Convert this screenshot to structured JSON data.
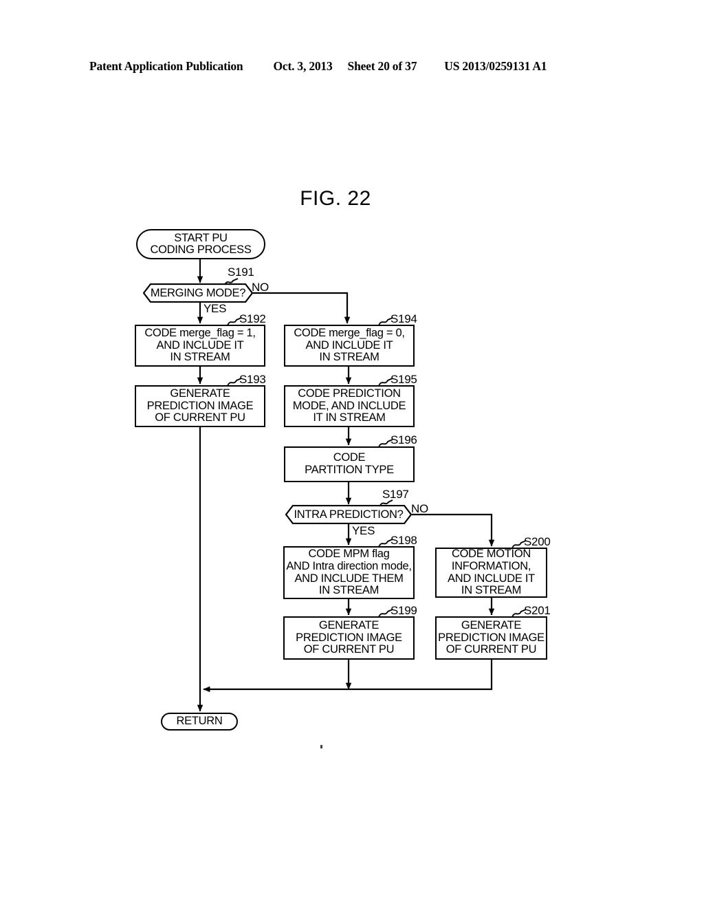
{
  "header": {
    "publication": "Patent Application Publication",
    "date": "Oct. 3, 2013",
    "sheet": "Sheet 20 of 37",
    "patent_number": "US 2013/0259131 A1"
  },
  "figure": {
    "title": "FIG. 22"
  },
  "flowchart": {
    "nodes": {
      "start": {
        "label": "START PU\nCODING PROCESS",
        "shape": "terminal"
      },
      "s191": {
        "step": "S191",
        "label": "MERGING MODE?",
        "shape": "decision",
        "yes_label": "YES",
        "no_label": "NO"
      },
      "s192": {
        "step": "S192",
        "label": "CODE merge_flag = 1,\nAND INCLUDE IT\nIN STREAM",
        "shape": "process"
      },
      "s193": {
        "step": "S193",
        "label": "GENERATE\nPREDICTION IMAGE\nOF CURRENT PU",
        "shape": "process"
      },
      "s194": {
        "step": "S194",
        "label": "CODE merge_flag = 0,\nAND INCLUDE IT\nIN STREAM",
        "shape": "process"
      },
      "s195": {
        "step": "S195",
        "label": "CODE PREDICTION\nMODE, AND INCLUDE\nIT IN STREAM",
        "shape": "process"
      },
      "s196": {
        "step": "S196",
        "label": "CODE\nPARTITION TYPE",
        "shape": "process"
      },
      "s197": {
        "step": "S197",
        "label": "INTRA PREDICTION?",
        "shape": "decision",
        "yes_label": "YES",
        "no_label": "NO"
      },
      "s198": {
        "step": "S198",
        "label": "CODE MPM flag\nAND Intra direction mode,\nAND INCLUDE THEM\nIN STREAM",
        "shape": "process"
      },
      "s199": {
        "step": "S199",
        "label": "GENERATE\nPREDICTION IMAGE\nOF CURRENT PU",
        "shape": "process"
      },
      "s200": {
        "step": "S200",
        "label": "CODE MOTION\nINFORMATION,\nAND INCLUDE IT\nIN STREAM",
        "shape": "process"
      },
      "s201": {
        "step": "S201",
        "label": "GENERATE\nPREDICTION IMAGE\nOF CURRENT PU",
        "shape": "process"
      },
      "return": {
        "label": "RETURN",
        "shape": "terminal"
      }
    },
    "colors": {
      "line": "#000000",
      "background": "#ffffff"
    }
  }
}
